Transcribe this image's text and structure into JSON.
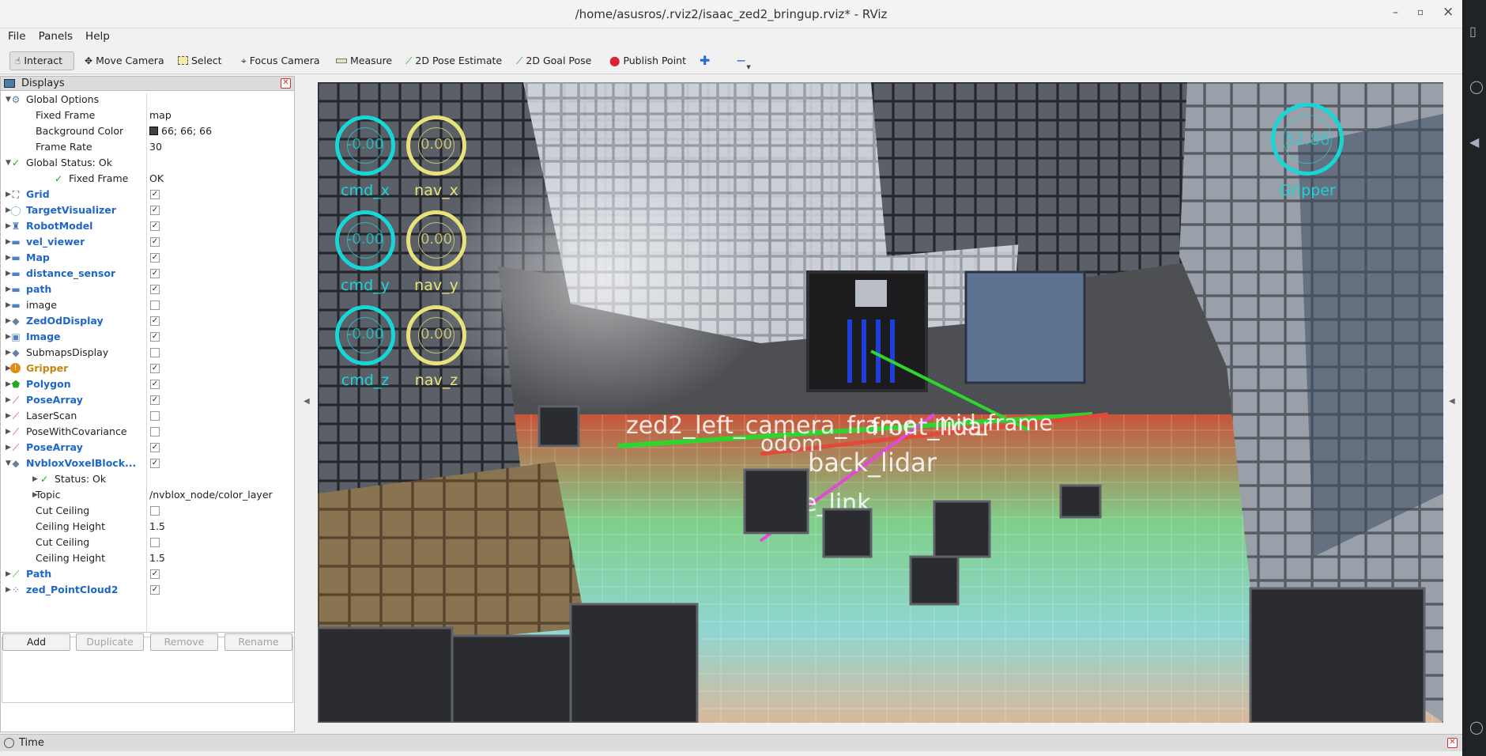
{
  "window": {
    "title": "/home/asusros/.rviz2/isaac_zed2_bringup.rviz* - RViz",
    "controls": {
      "minimize": "–",
      "maximize": "▫",
      "close": "×"
    }
  },
  "menu": [
    "File",
    "Panels",
    "Help"
  ],
  "toolbar": [
    {
      "label": "Interact",
      "icon": "interact-icon",
      "active": true
    },
    {
      "label": "Move Camera",
      "icon": "move-camera-icon"
    },
    {
      "label": "Select",
      "icon": "select-icon"
    },
    {
      "label": "Focus Camera",
      "icon": "focus-camera-icon"
    },
    {
      "label": "Measure",
      "icon": "measure-icon"
    },
    {
      "label": "2D Pose Estimate",
      "icon": "pose-estimate-icon"
    },
    {
      "label": "2D Goal Pose",
      "icon": "goal-pose-icon"
    },
    {
      "label": "Publish Point",
      "icon": "publish-point-icon"
    },
    {
      "label": "",
      "icon": "add-tool-icon"
    },
    {
      "label": "",
      "icon": "remove-tool-icon"
    }
  ],
  "displays_panel": {
    "title": "Displays",
    "rows": [
      {
        "label": "Global Options",
        "expanded": true,
        "icon": "gear"
      },
      {
        "label": "Fixed Frame",
        "value": "map",
        "child": 1
      },
      {
        "label": "Background Color",
        "value": "66; 66; 66",
        "swatch": true,
        "child": 1
      },
      {
        "label": "Frame Rate",
        "value": "30",
        "child": 1
      },
      {
        "label": "Global Status: Ok",
        "expanded": true,
        "icon": "check"
      },
      {
        "label": "Fixed Frame",
        "value": "OK",
        "child": 2,
        "icon": "check"
      },
      {
        "label": "Grid",
        "checked": true,
        "style": "blue",
        "icon": "grid"
      },
      {
        "label": "TargetVisualizer",
        "checked": true,
        "style": "blue",
        "icon": "target"
      },
      {
        "label": "RobotModel",
        "checked": true,
        "style": "blue",
        "icon": "robot"
      },
      {
        "label": "vel_viewer",
        "checked": true,
        "style": "blue",
        "icon": "folder"
      },
      {
        "label": "Map",
        "checked": true,
        "style": "blue",
        "icon": "folder"
      },
      {
        "label": "distance_sensor",
        "checked": true,
        "style": "blue",
        "icon": "folder"
      },
      {
        "label": "path",
        "checked": true,
        "style": "blue",
        "icon": "folder"
      },
      {
        "label": "image",
        "checked": false,
        "icon": "folder"
      },
      {
        "label": "ZedOdDisplay",
        "checked": true,
        "style": "blue",
        "icon": "diamond"
      },
      {
        "label": "Image",
        "checked": true,
        "style": "blue",
        "icon": "image"
      },
      {
        "label": "SubmapsDisplay",
        "checked": false,
        "icon": "diamond"
      },
      {
        "label": "Gripper",
        "checked": true,
        "style": "orange",
        "icon": "warn"
      },
      {
        "label": "Polygon",
        "checked": true,
        "style": "blue",
        "icon": "polygon"
      },
      {
        "label": "PoseArray",
        "checked": true,
        "style": "blue",
        "icon": "posearray"
      },
      {
        "label": "LaserScan",
        "checked": false,
        "icon": "laser"
      },
      {
        "label": "PoseWithCovariance",
        "checked": false,
        "icon": "posecov"
      },
      {
        "label": "PoseArray",
        "checked": true,
        "style": "blue",
        "icon": "posearray"
      },
      {
        "label": "NvbloxVoxelBlock...",
        "checked": true,
        "style": "blue",
        "expanded": true,
        "icon": "diamond"
      },
      {
        "label": "Status: Ok",
        "child": 1,
        "icon": "check",
        "collapsed": true
      },
      {
        "label": "Topic",
        "value": "/nvblox_node/color_layer",
        "child": 1,
        "collapsed": true
      },
      {
        "label": "Cut Ceiling",
        "checked": false,
        "child": 1
      },
      {
        "label": "Ceiling Height",
        "value": "1.5",
        "child": 1
      },
      {
        "label": "Cut Ceiling",
        "checked": false,
        "child": 1
      },
      {
        "label": "Ceiling Height",
        "value": "1.5",
        "child": 1
      },
      {
        "label": "Path",
        "checked": true,
        "style": "blue",
        "icon": "path"
      },
      {
        "label": "zed_PointCloud2",
        "checked": true,
        "style": "blue",
        "icon": "pointcloud"
      }
    ],
    "buttons": [
      {
        "label": "Add",
        "disabled": false
      },
      {
        "label": "Duplicate",
        "disabled": true
      },
      {
        "label": "Remove",
        "disabled": true
      },
      {
        "label": "Rename",
        "disabled": true
      }
    ]
  },
  "viewport": {
    "gauges": [
      {
        "value": "-0.00",
        "label": "cmd_x",
        "color": "#19d6d6"
      },
      {
        "value": "0.00",
        "label": "nav_x",
        "color": "#e8e27a"
      },
      {
        "value": "-0.00",
        "label": "cmd_y",
        "color": "#19d6d6"
      },
      {
        "value": "0.00",
        "label": "nav_y",
        "color": "#e8e27a"
      },
      {
        "value": "-0.00",
        "label": "cmd_z",
        "color": "#19d6d6"
      },
      {
        "value": "0.00",
        "label": "nav_z",
        "color": "#e8e27a"
      },
      {
        "value": "52.86",
        "label": "Gripper",
        "color": "#19d6d6"
      }
    ],
    "frame_labels": [
      "zed2_left_camera_frame",
      "base_link",
      "back_lidar",
      "front_lidar",
      "odom",
      "mid_frame"
    ],
    "background_color": "#424242"
  },
  "time_panel": {
    "title": "Time"
  }
}
